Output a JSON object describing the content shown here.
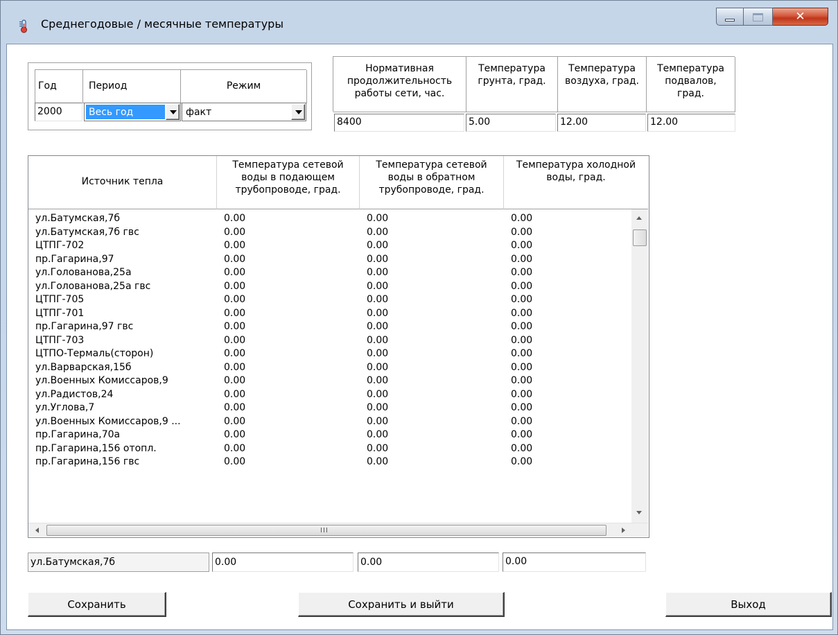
{
  "window": {
    "title": "Среднегодовые / месячные температуры",
    "icon": "thermometer-icon",
    "controls": {
      "minimize": "minimize-icon",
      "maximize": "maximize-icon",
      "close": "✕"
    }
  },
  "filters": {
    "year_label": "Год",
    "period_label": "Период",
    "mode_label": "Режим",
    "year_value": "2000",
    "period_value": "Весь год",
    "mode_value": "факт"
  },
  "norms": {
    "headers": [
      [
        "Нормативная",
        "продолжительность",
        "работы сети, час."
      ],
      [
        "Температура",
        "грунта, град."
      ],
      [
        "Температура",
        "воздуха, град."
      ],
      [
        "Температура",
        "подвалов,",
        "град."
      ]
    ],
    "values": [
      "8400",
      "5.00",
      "12.00",
      "12.00"
    ]
  },
  "table": {
    "columns": [
      [
        "Источник тепла"
      ],
      [
        "Температура сетевой",
        "воды в подающем",
        "трубопроводе, град."
      ],
      [
        "Температура сетевой",
        "воды в обратном",
        "трубопроводе, град."
      ],
      [
        "Температура холодной",
        "воды, град."
      ]
    ],
    "rows": [
      [
        "ул.Батумская,7б",
        "0.00",
        "0.00",
        "0.00"
      ],
      [
        "ул.Батумская,7б гвс",
        "0.00",
        "0.00",
        "0.00"
      ],
      [
        "ЦТПГ-702",
        "0.00",
        "0.00",
        "0.00"
      ],
      [
        "пр.Гагарина,97",
        "0.00",
        "0.00",
        "0.00"
      ],
      [
        "ул.Голованова,25а",
        "0.00",
        "0.00",
        "0.00"
      ],
      [
        "ул.Голованова,25а гвс",
        "0.00",
        "0.00",
        "0.00"
      ],
      [
        "ЦТПГ-705",
        "0.00",
        "0.00",
        "0.00"
      ],
      [
        "ЦТПГ-701",
        "0.00",
        "0.00",
        "0.00"
      ],
      [
        "пр.Гагарина,97 гвс",
        "0.00",
        "0.00",
        "0.00"
      ],
      [
        "ЦТПГ-703",
        "0.00",
        "0.00",
        "0.00"
      ],
      [
        "ЦТПО-Термаль(сторон)",
        "0.00",
        "0.00",
        "0.00"
      ],
      [
        "ул.Варварская,15б",
        "0.00",
        "0.00",
        "0.00"
      ],
      [
        "ул.Военных Комиссаров,9",
        "0.00",
        "0.00",
        "0.00"
      ],
      [
        "ул.Радистов,24",
        "0.00",
        "0.00",
        "0.00"
      ],
      [
        "ул.Углова,7",
        "0.00",
        "0.00",
        "0.00"
      ],
      [
        "ул.Военных Комиссаров,9 ...",
        "0.00",
        "0.00",
        "0.00"
      ],
      [
        "пр.Гагарина,70а",
        "0.00",
        "0.00",
        "0.00"
      ],
      [
        "пр.Гагарина,156 отопл.",
        "0.00",
        "0.00",
        "0.00"
      ],
      [
        "пр.Гагарина,156 гвс",
        "0.00",
        "0.00",
        "0.00"
      ]
    ]
  },
  "selected": {
    "source": "ул.Батумская,7б",
    "supply": "0.00",
    "return": "0.00",
    "cold": "0.00"
  },
  "buttons": {
    "save": "Сохранить",
    "save_exit": "Сохранить и выйти",
    "exit": "Выход"
  },
  "colors": {
    "selection": "#3399ff",
    "window_chrome": "#c9d9ec",
    "close_button": "#c7401f"
  }
}
